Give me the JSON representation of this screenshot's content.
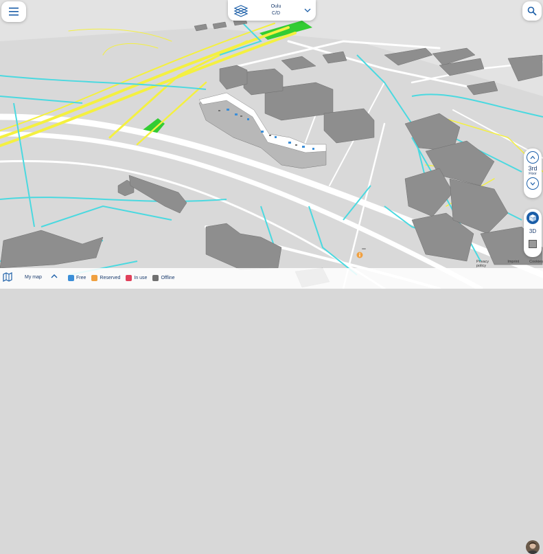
{
  "location": {
    "city": "Oulu",
    "building": "C/D"
  },
  "floor": {
    "number": "3rd",
    "label": "Floor"
  },
  "view": {
    "mode_label": "3D"
  },
  "footer": {
    "privacy": "Privacy policy",
    "imprint": "Imprint",
    "cookies": "Cookies"
  },
  "bottom_bar": {
    "my_map": "My map",
    "legend": [
      {
        "label": "Free",
        "color": "#3b8ed8"
      },
      {
        "label": "Reserved",
        "color": "#f0a040"
      },
      {
        "label": "In use",
        "color": "#e0405a"
      },
      {
        "label": "Offline",
        "color": "#707070"
      }
    ]
  },
  "colors": {
    "accent": "#1b5ea8",
    "road_cyan": "#4ad9e0",
    "road_yellow": "#f4f040",
    "building": "#8e8e8e",
    "park": "#33cc33"
  },
  "icons": {
    "menu": "hamburger-icon",
    "search": "search-icon",
    "building": "building-icon",
    "chevron": "chevron-down-icon",
    "cube": "cube-icon",
    "poi": "info-marker-icon"
  }
}
